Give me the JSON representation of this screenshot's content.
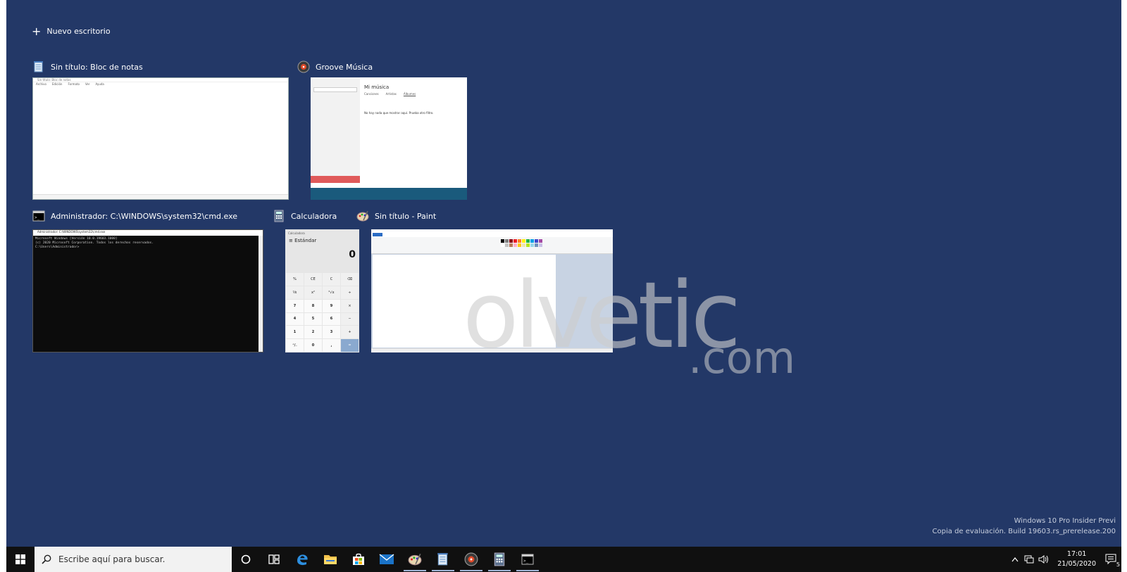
{
  "new_desktop": {
    "label": "Nuevo escritorio"
  },
  "windows": {
    "notepad": {
      "title": "Sin título: Bloc de notas",
      "inner_title": "Sin título: Bloc de notas",
      "menu": [
        "Archivo",
        "Edición",
        "Formato",
        "Ver",
        "Ayuda"
      ]
    },
    "groove": {
      "title": "Groove Música",
      "heading": "Mi música",
      "tabs": [
        "Canciones",
        "Artistas",
        "Álbumes"
      ],
      "message": "No hay nada que mostrar aquí. Prueba otro filtro."
    },
    "cmd": {
      "title": "Administrador: C:\\WINDOWS\\system32\\cmd.exe",
      "inner_title": "Administrador: C:\\WINDOWS\\system32\\cmd.exe",
      "lines": [
        "Microsoft Windows [Versión 10.0.19603.1000]",
        "(c) 2020 Microsoft Corporation. Todos los derechos reservados.",
        "",
        "C:\\Users\\Administrador>"
      ]
    },
    "calc": {
      "title": "Calculadora",
      "app_label": "Calculadora",
      "mode": "Estándar",
      "display": "0",
      "memory": [
        "MC",
        "MR",
        "M+",
        "M-",
        "MS"
      ],
      "keys": [
        "%",
        "CE",
        "C",
        "⌫",
        "⅟x",
        "x²",
        "²√x",
        "÷",
        "7",
        "8",
        "9",
        "×",
        "4",
        "5",
        "6",
        "−",
        "1",
        "2",
        "3",
        "+",
        "⁺/₋",
        "0",
        ",",
        "="
      ]
    },
    "paint": {
      "title": "Sin título - Paint",
      "palette": [
        "#000000",
        "#7f7f7f",
        "#880015",
        "#ed1c24",
        "#ff7f27",
        "#fff200",
        "#22b14c",
        "#00a2e8",
        "#3f48cc",
        "#a349a4",
        "#ffffff",
        "#c3c3c3",
        "#b97a57",
        "#ffaec9",
        "#ffc90e",
        "#efe4b0",
        "#b5e61d",
        "#99d9ea",
        "#7092be",
        "#c8bfe7"
      ]
    }
  },
  "watermark": {
    "main": "olvetic",
    "suffix": ".com"
  },
  "build_info": {
    "line1": "Windows 10 Pro Insider Previ",
    "line2": "Copia de evaluación. Build 19603.rs_prerelease.200"
  },
  "taskbar": {
    "start_icon": "windows-logo-icon",
    "search_placeholder": "Escribe aquí para buscar.",
    "pinned": [
      {
        "name": "cortana",
        "icon": "circle-icon"
      },
      {
        "name": "task-view",
        "icon": "task-view-icon"
      },
      {
        "name": "edge",
        "icon": "edge-icon"
      },
      {
        "name": "explorer",
        "icon": "folder-icon"
      },
      {
        "name": "store",
        "icon": "store-icon"
      },
      {
        "name": "mail",
        "icon": "mail-icon"
      },
      {
        "name": "paint",
        "icon": "paint-icon"
      },
      {
        "name": "notepad",
        "icon": "notepad-icon"
      },
      {
        "name": "groove",
        "icon": "groove-icon"
      },
      {
        "name": "calculator",
        "icon": "calculator-icon"
      },
      {
        "name": "cmd",
        "icon": "cmd-icon"
      }
    ],
    "time": "17:01",
    "date": "21/05/2020",
    "notification_count": "5"
  },
  "colors": {
    "desktop_bg": "#233867",
    "taskbar_bg": "#101010",
    "accent": "#9fb5d6"
  }
}
